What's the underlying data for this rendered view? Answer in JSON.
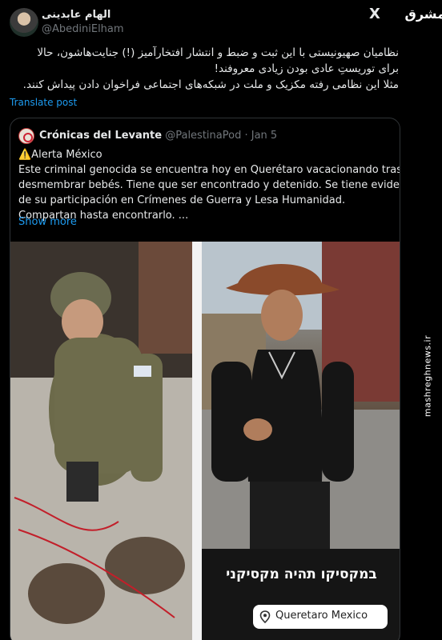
{
  "tweet": {
    "author_name": "الهام عابدینی",
    "handle": "@AbediniElham",
    "body_line1": "نظامیان صهیونیستی با این ثبت و ضبط و انتشار افتخارآمیز (!) جنایت‌هاشون، حالا",
    "body_line2": "برای توریستِ عادی بودن زیادی معروفند!",
    "body_line3": "مثلا این نظامی رفته مکزیک و ملت در شبکه‌های اجتماعی فراخوان دادن پیداش کنند.",
    "translate_label": "Translate post"
  },
  "quoted": {
    "name": "Crónicas del Levante",
    "handle": "@PalestinaPod",
    "date": "Jan 5",
    "line1": "⚠️Alerta México",
    "line2": "Este criminal genocida se encuentra hoy en Querétaro vacacionando tras",
    "line3": "desmembrar bebés. Tiene que ser encontrado y detenido. Se tiene evidencia",
    "line4": "de su participación en Crímenes de Guerra y Lesa Humanidad.",
    "line5": "Compartan hasta encontrarlo. ...",
    "show_more": "Show more",
    "caption_hebrew": "במקסיקו תהיה מקסיקני",
    "location": "Queretaro Mexico"
  },
  "watermark": {
    "logo": "مشرق",
    "url": "mashreghnews.ir"
  },
  "icons": [
    "x-logo-icon",
    "location-pin-icon",
    "warning-icon"
  ]
}
